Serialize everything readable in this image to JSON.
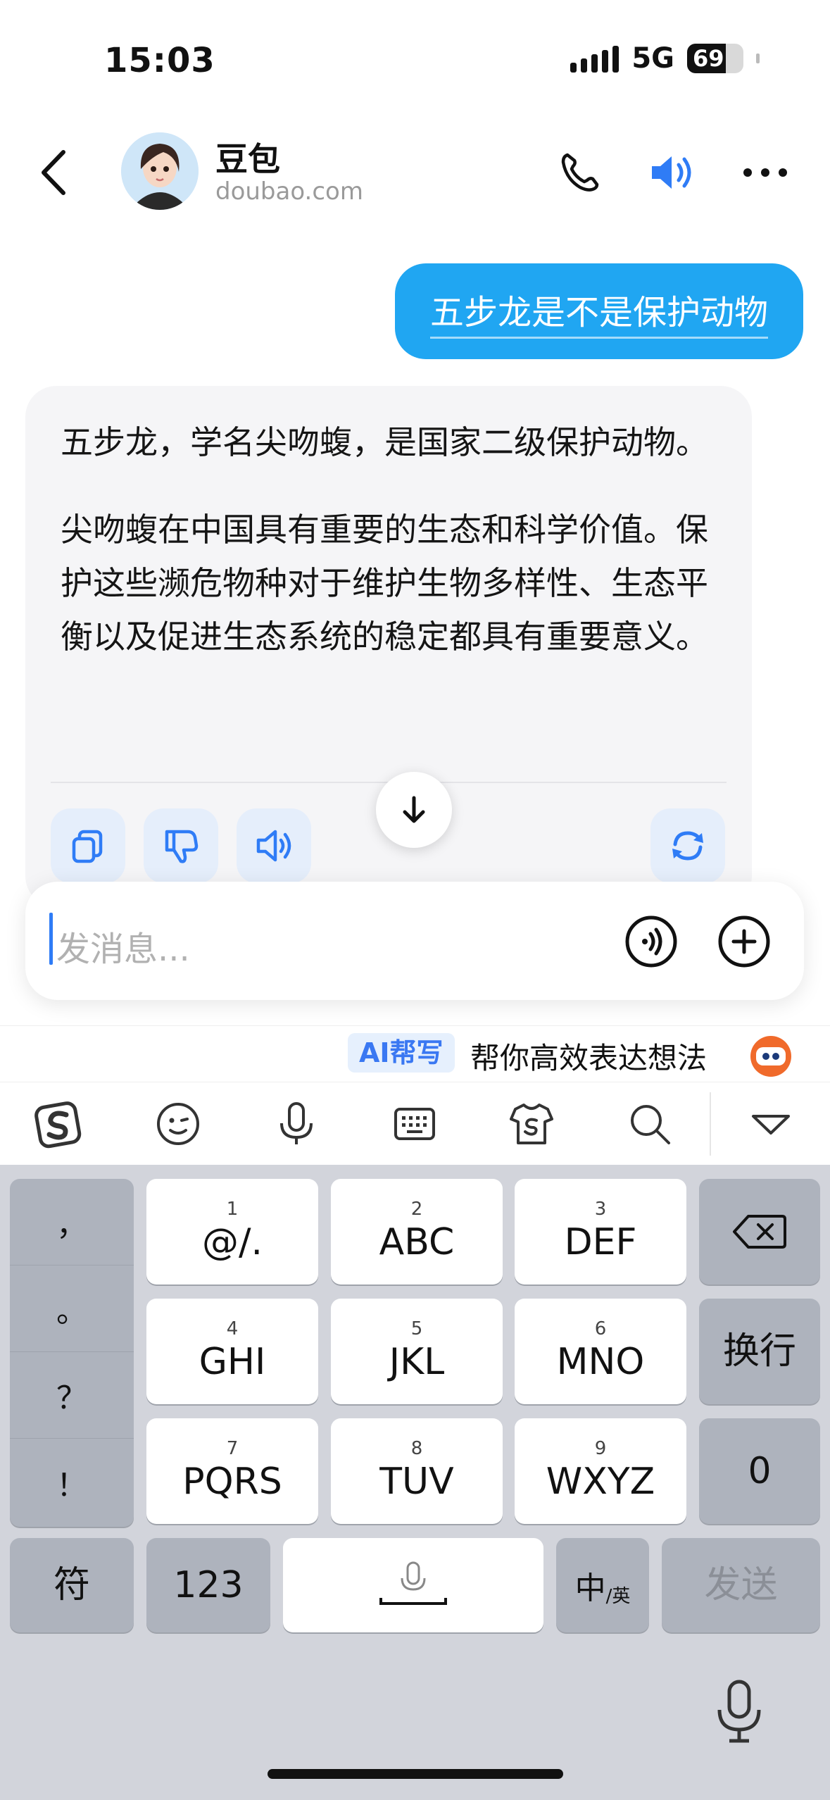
{
  "status_bar": {
    "time": "15:03",
    "network": "5G",
    "battery": "69"
  },
  "header": {
    "name": "豆包",
    "subtitle": "doubao.com"
  },
  "chat": {
    "user_message": "五步龙是不是保护动物",
    "bot_paragraphs": [
      "五步龙，学名尖吻蝮，是国家二级保护动物。",
      "尖吻蝮在中国具有重要的生态和科学价值。保护这些濒危物种对于维护生物多样性、生态平衡以及促进生态系统的稳定都具有重要意义。"
    ]
  },
  "input": {
    "placeholder": "发消息..."
  },
  "assist": {
    "tag": "AI帮写",
    "text": "帮你高效表达想法"
  },
  "keyboard": {
    "punct": [
      "，",
      "。",
      "？",
      "！"
    ],
    "keys": [
      {
        "num": "1",
        "label": "@/."
      },
      {
        "num": "2",
        "label": "ABC"
      },
      {
        "num": "3",
        "label": "DEF"
      },
      {
        "num": "4",
        "label": "GHI"
      },
      {
        "num": "5",
        "label": "JKL"
      },
      {
        "num": "6",
        "label": "MNO"
      },
      {
        "num": "7",
        "label": "PQRS"
      },
      {
        "num": "8",
        "label": "TUV"
      },
      {
        "num": "9",
        "label": "WXYZ"
      }
    ],
    "newline": "换行",
    "zero": "0",
    "symbols": "符",
    "numbers": "123",
    "lang_main": "中",
    "lang_sub": "/英",
    "send": "发送"
  },
  "colors": {
    "accent": "#20a6f2",
    "link_blue": "#2f7cf6"
  }
}
